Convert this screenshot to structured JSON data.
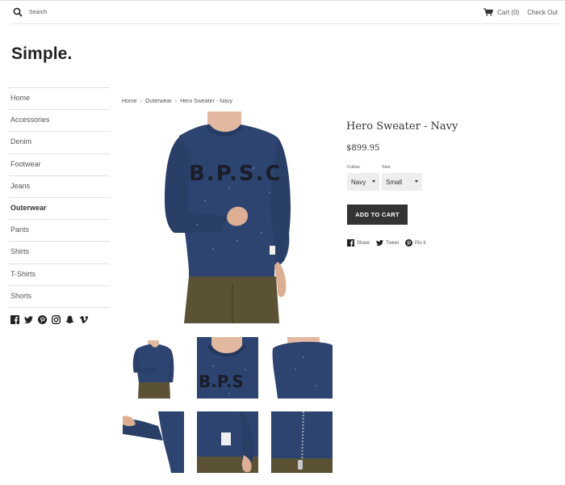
{
  "header": {
    "search_placeholder": "Search",
    "cart_label": "Cart (0)",
    "checkout_label": "Check Out"
  },
  "site": {
    "logo": "Simple."
  },
  "sidebar": {
    "items": [
      {
        "label": "Home"
      },
      {
        "label": "Accessories"
      },
      {
        "label": "Denim"
      },
      {
        "label": "Footwear"
      },
      {
        "label": "Jeans"
      },
      {
        "label": "Outerwear",
        "active": true
      },
      {
        "label": "Pants"
      },
      {
        "label": "Shirts"
      },
      {
        "label": "T-Shirts"
      },
      {
        "label": "Shorts"
      }
    ],
    "social_icons": [
      "facebook-icon",
      "twitter-icon",
      "pinterest-icon",
      "instagram-icon",
      "snapchat-icon",
      "vimeo-icon"
    ]
  },
  "breadcrumb": {
    "home": "Home",
    "category": "Outerwear",
    "current": "Hero Sweater - Navy",
    "separator": "›"
  },
  "product": {
    "title": "Hero Sweater - Navy",
    "price": "$899.95",
    "colour_label": "Colour",
    "colour_value": "Navy",
    "size_label": "Size",
    "size_value": "Small",
    "add_to_cart": "ADD TO CART",
    "share": "Share",
    "tweet": "Tweet",
    "pin": "Pin it",
    "thumbnails": 6
  },
  "colors": {
    "sweater": "#2d4470",
    "pants": "#5b5236",
    "button": "#333333",
    "select_bg": "#eeeeee"
  }
}
